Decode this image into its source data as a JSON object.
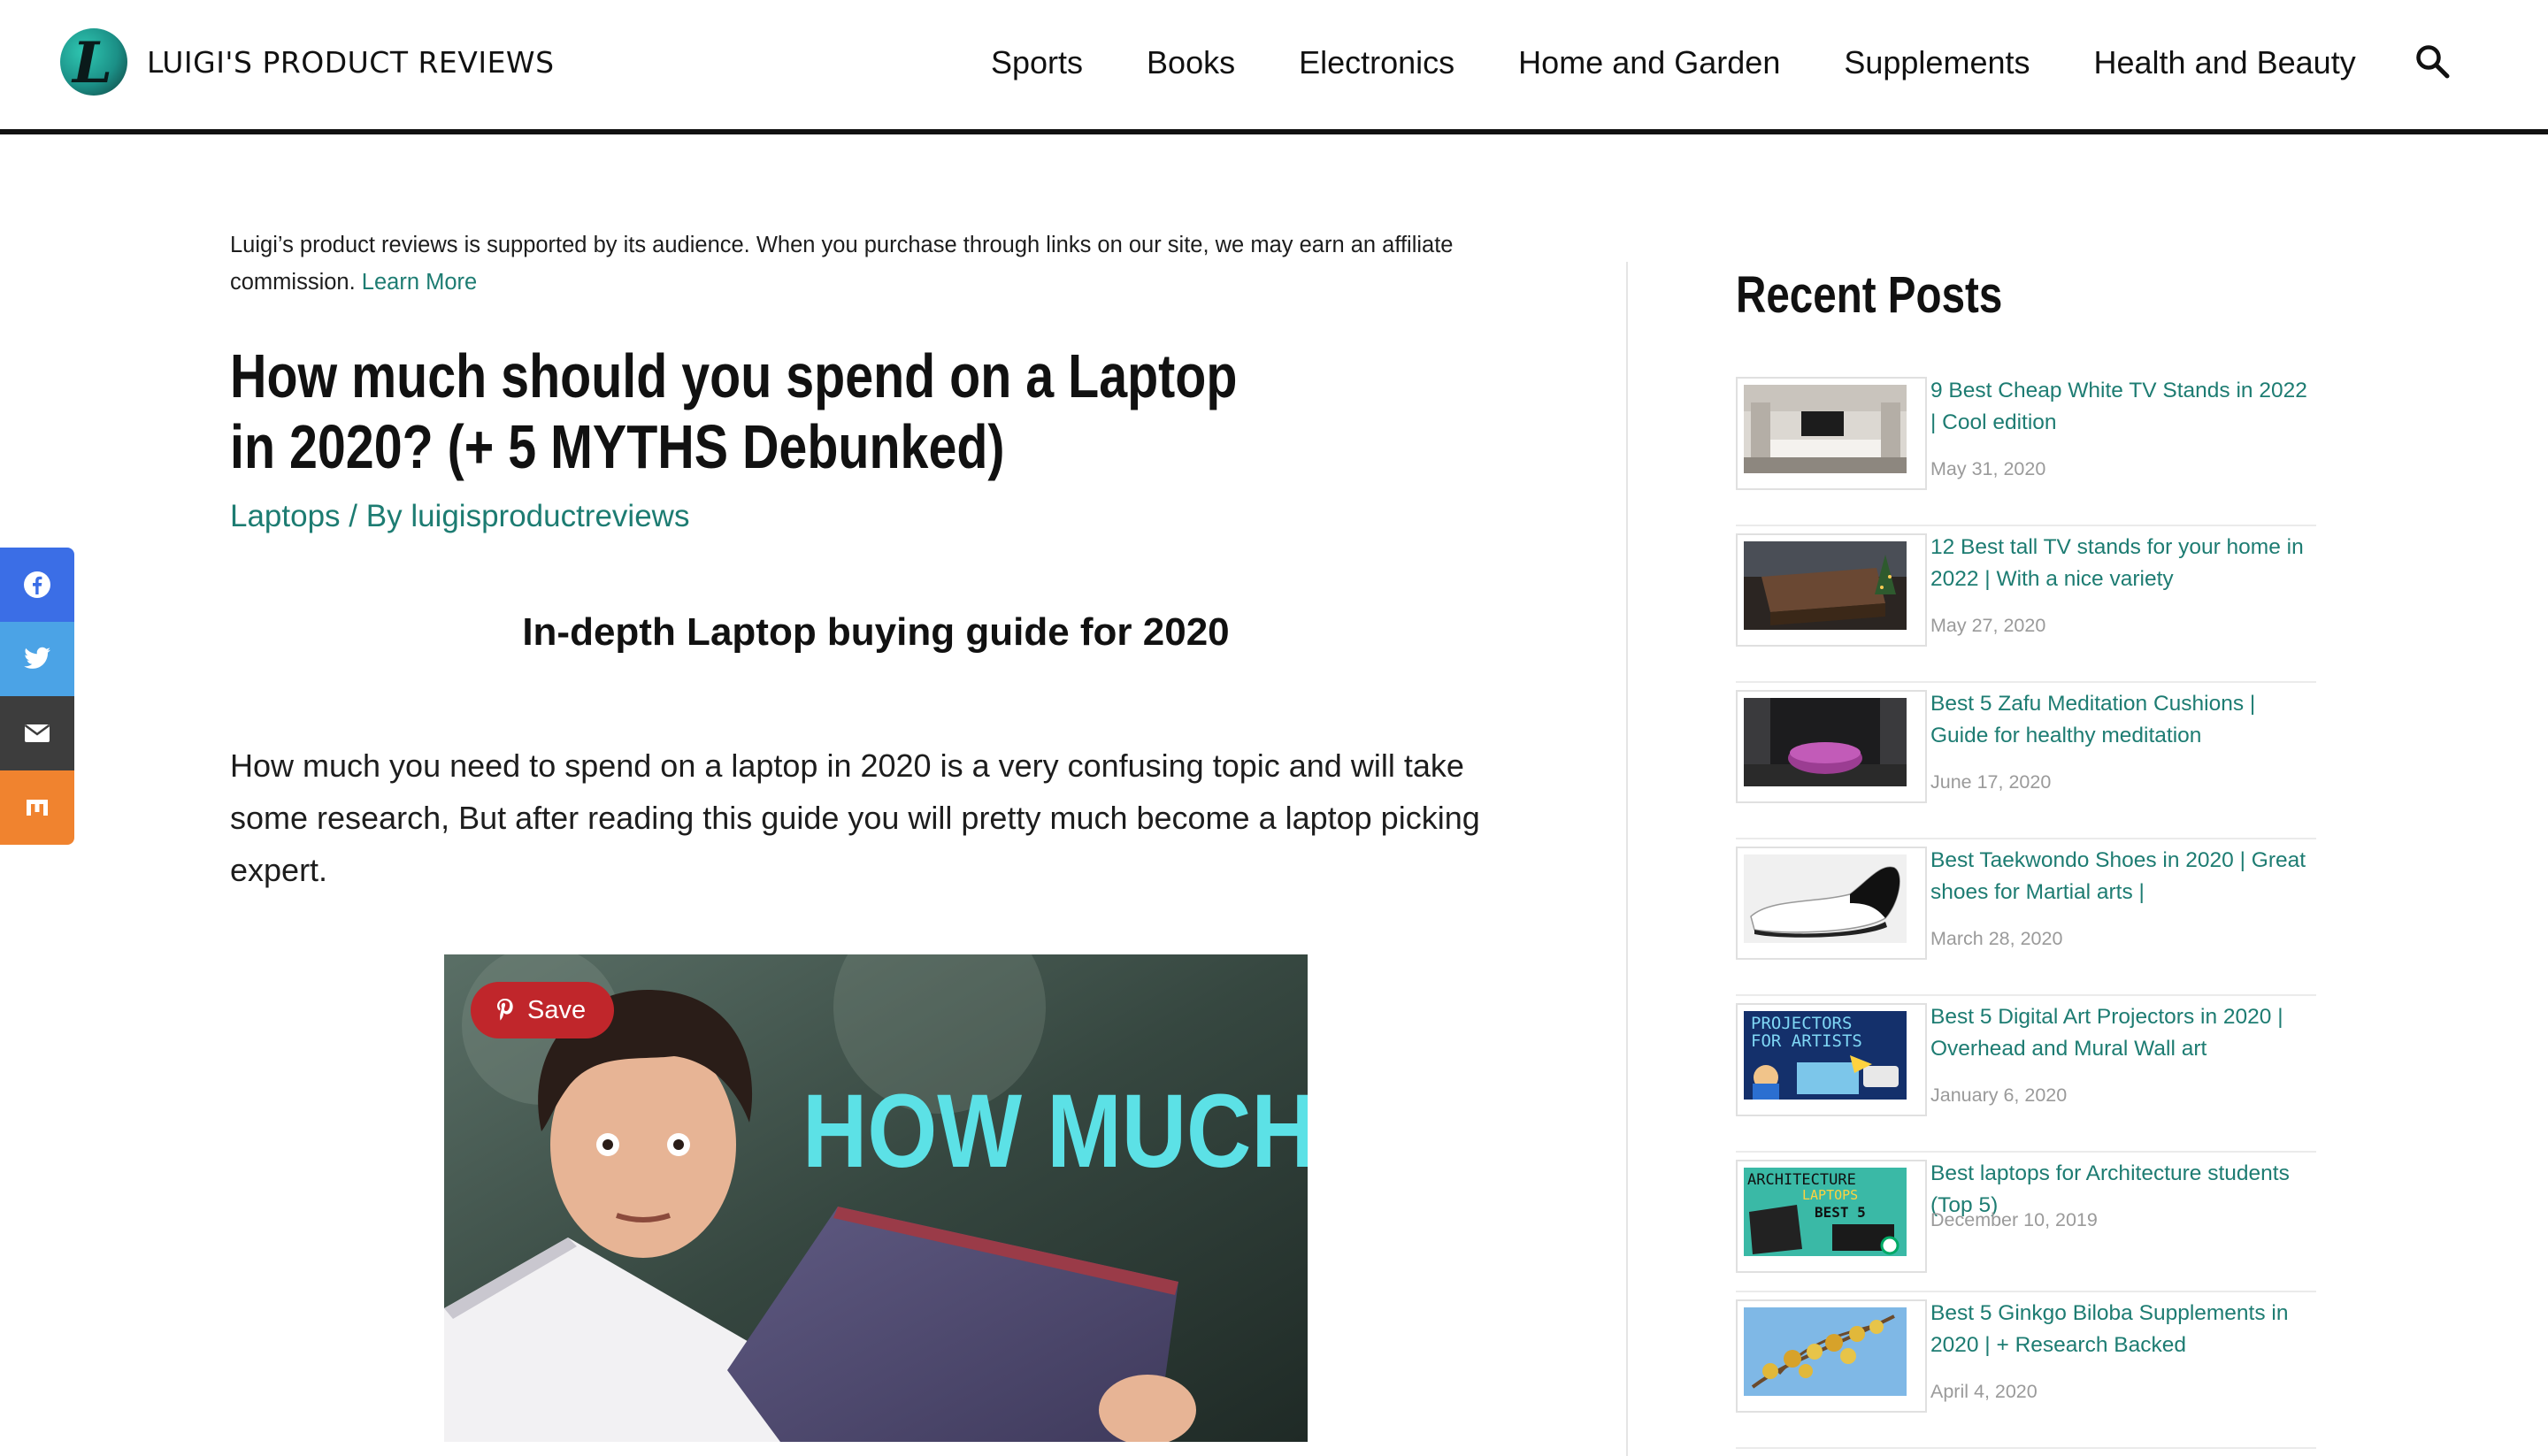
{
  "site": {
    "name": "LUIGI'S PRODUCT REVIEWS"
  },
  "nav": {
    "items": [
      "Sports",
      "Books",
      "Electronics",
      "Home and Garden",
      "Supplements",
      "Health and Beauty"
    ],
    "search_icon": "search-icon"
  },
  "share": {
    "buttons": [
      {
        "icon": "facebook-icon",
        "color": "#3b6ee6"
      },
      {
        "icon": "twitter-icon",
        "color": "#4ba3e6"
      },
      {
        "icon": "email-icon",
        "color": "#3d3d3d"
      },
      {
        "icon": "mix-icon",
        "color": "#f0832f"
      }
    ]
  },
  "article": {
    "disclosure_text": "Luigi’s product reviews is supported by its audience. When you purchase through links on our site, we may earn an affiliate commission.",
    "learn_more": "Learn More",
    "title": "How much should you spend on a Laptop in 2020? (+ 5 MYTHS Debunked)",
    "category": "Laptops",
    "by_text": " / By ",
    "author": "luigisproductreviews",
    "subtitle": "In-depth Laptop buying guide for 2020",
    "intro": "How much you need to spend on a laptop in 2020 is a very confusing topic and will take some research, But after reading this guide you will pretty much become a laptop picking expert.",
    "hero_image": {
      "overlay_text": "HOW MUCH?!",
      "save_label": "Save"
    }
  },
  "sidebar": {
    "title": "Recent Posts",
    "posts": [
      {
        "title": "9 Best Cheap White TV Stands in 2022 | Cool edition",
        "date": "May 31, 2020"
      },
      {
        "title": "12 Best tall TV stands for your home in 2022 | With a nice variety",
        "date": "May 27, 2020"
      },
      {
        "title": "Best 5 Zafu Meditation Cushions | Guide for healthy meditation",
        "date": "June 17, 2020"
      },
      {
        "title": "Best Taekwondo Shoes in 2020 | Great shoes for Martial arts |",
        "date": "March 28, 2020"
      },
      {
        "title": "Best 5 Digital Art Projectors in 2020 | Overhead and Mural Wall art",
        "date": "January 6, 2020",
        "thumb_text": [
          "PROJECTORS",
          "FOR ARTISTS"
        ]
      },
      {
        "title": "Best laptops for Architecture students (Top 5)",
        "date": "December 10, 2019",
        "thumb_text": [
          "ARCHITECTURE",
          "LAPTOPS",
          "BEST 5"
        ]
      },
      {
        "title": "Best 5 Ginkgo Biloba Supplements in 2020 | + Research Backed",
        "date": "April 4, 2020"
      }
    ]
  },
  "colors": {
    "accent": "#1d7c72",
    "save_red": "#c0262b",
    "hero_text": "#5ce1e6"
  }
}
